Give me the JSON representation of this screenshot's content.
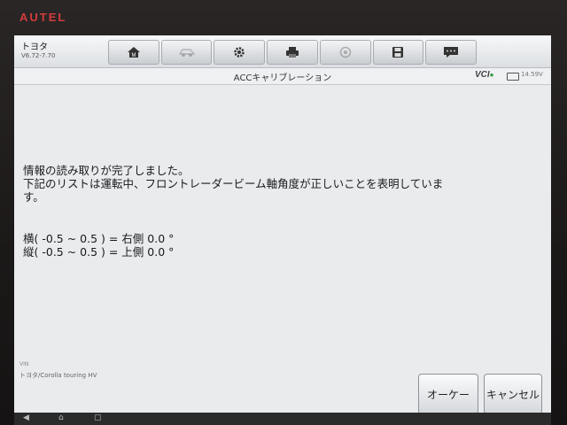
{
  "device": {
    "brand": "AUTEL"
  },
  "toolbar": {
    "vehicle": "トヨタ",
    "version": "V6.72-7.70",
    "icons": [
      {
        "name": "home-icon",
        "enabled": true
      },
      {
        "name": "vehicle-swap-icon",
        "enabled": false
      },
      {
        "name": "settings-icon",
        "enabled": true
      },
      {
        "name": "print-icon",
        "enabled": true
      },
      {
        "name": "help-icon",
        "enabled": false
      },
      {
        "name": "save-icon",
        "enabled": true
      },
      {
        "name": "chat-icon",
        "enabled": true
      }
    ]
  },
  "header": {
    "title": "ACCキャリブレーション",
    "vci": "VCI",
    "voltage": "14.59V"
  },
  "message": {
    "line1": "情報の読み取りが完了しました。",
    "line2": "下記のリストは運転中、フロントレーダービーム軸角度が正しいことを表明していま",
    "line3": "す。"
  },
  "values": {
    "horizontal": "横( -0.5 ~ 0.5 ) = 右側 0.0 °",
    "vertical": "縦( -0.5 ~ 0.5 ) = 上側 0.0 °"
  },
  "footer": {
    "vin_label": "VIN",
    "vehicle_model": "トヨタ/Corolla touring HV"
  },
  "buttons": {
    "ok": "オーケー",
    "cancel": "キャンセル"
  },
  "colors": {
    "brand": "#d23b3b",
    "vci_status": "#2e9a3a"
  }
}
